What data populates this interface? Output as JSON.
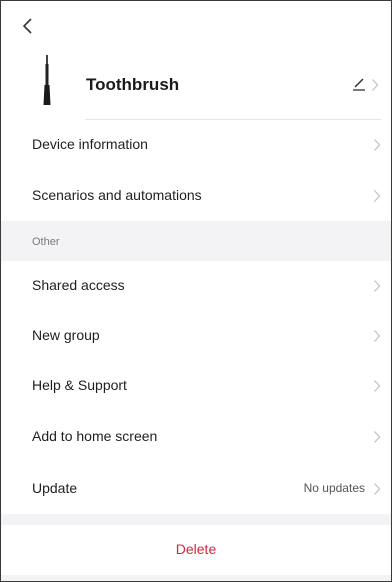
{
  "nav": {
    "back_icon": "chevron-left-icon"
  },
  "device": {
    "name": "Toothbrush",
    "thumbnail_icon": "toothbrush-icon",
    "edit_icon": "pencil-icon"
  },
  "main_items": [
    {
      "label": "Device information"
    },
    {
      "label": "Scenarios and automations"
    }
  ],
  "other_section": {
    "title": "Other",
    "items": [
      {
        "label": "Shared access"
      },
      {
        "label": "New group"
      },
      {
        "label": "Help & Support"
      },
      {
        "label": "Add to home screen"
      },
      {
        "label": "Update",
        "value": "No updates"
      }
    ]
  },
  "delete": {
    "label": "Delete",
    "color": "#d02a3a"
  },
  "colors": {
    "background": "#ffffff",
    "section_background": "#f3f3f6",
    "chevron": "#c4c4c8"
  }
}
